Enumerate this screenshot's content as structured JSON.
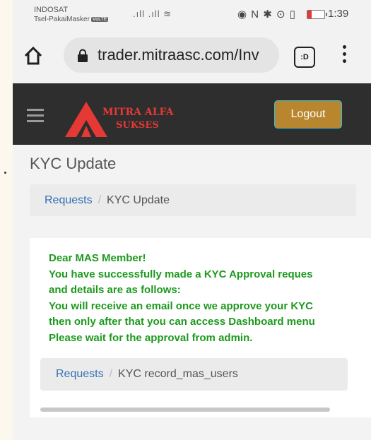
{
  "status_bar": {
    "carrier_primary": "INDOSAT",
    "carrier_secondary": "Tsel-PakaiMasker",
    "volte_badge": "VoLTE",
    "signal_glyphs": ".ıll .ıll ≋",
    "system_icons": "◉ N ✱ ⊙ ▯",
    "time": "1:39"
  },
  "browser": {
    "url": "trader.mitraasc.com/Inv",
    "tab_badge": ":D"
  },
  "navbar": {
    "brand_line1": "MITRA ALFA",
    "brand_line2": "SUKSES",
    "logout_label": "Logout"
  },
  "page": {
    "title": "KYC Update",
    "breadcrumb": {
      "link": "Requests",
      "separator": "/",
      "current": "KYC Update"
    }
  },
  "message": {
    "lines": [
      "Dear MAS Member!",
      "You have successfully made a KYC Approval reques",
      "and details are as follows:",
      "You will receive an email once we approve your KYC",
      "then only after that you can access Dashboard menu",
      "Please wait for the approval from admin."
    ]
  },
  "card_breadcrumb": {
    "link": "Requests",
    "separator": "/",
    "current": "KYC record_mas_users"
  },
  "colors": {
    "navbar_bg": "#2e2e2e",
    "brand_red": "#e53935",
    "logout_bg": "#b8862e",
    "message_green": "#1d9a1d",
    "link_blue": "#3371b5"
  }
}
